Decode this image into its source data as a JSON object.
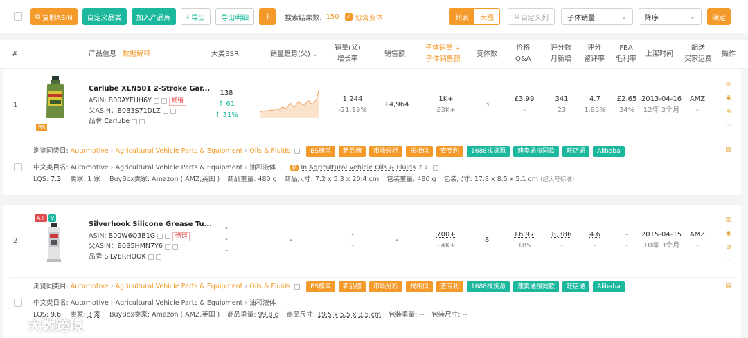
{
  "toolbar": {
    "copy_asin": "复制ASIN",
    "custom_category": "自定义品类",
    "add_to_library": "加入产品库",
    "export": "导出",
    "export_detail": "导出明细",
    "more": "⋮",
    "result_label": "搜索结果数:",
    "result_count": "150",
    "include_variants": "包含变体",
    "view_list": "列表",
    "view_grid": "大图",
    "custom_columns": "自定义列",
    "sort_field": "子体销量",
    "sort_order": "降序",
    "confirm": "确定"
  },
  "headers": {
    "index": "#",
    "product_info": "产品信息",
    "data_explain": "数据解释",
    "bsr": "大类BSR",
    "sales_trend": "销量趋势(父)",
    "sales_parent": "销量(父)",
    "growth": "增长率",
    "revenue": "销售额",
    "child_sales": "子体销量",
    "child_revenue": "子体销售额",
    "variants": "变体数",
    "price": "价格",
    "qa": "Q&A",
    "reviews": "评分数",
    "monthly_new": "月新增",
    "rating": "评分",
    "retention": "留评率",
    "fba": "FBA",
    "margin": "毛利率",
    "launch": "上架时间",
    "delivery": "配送",
    "buyer_shipping": "买家运费",
    "ops": "操作"
  },
  "products": [
    {
      "index": "1",
      "title": "Carlube XLN501 2-Stroke Gar...",
      "asin_label": "ASIN:",
      "asin": "B00AYEUH6Y",
      "hot": "畅销",
      "parent_label": "父ASIN：",
      "parent_asin": "B0B3S71DLZ",
      "brand_label": "品牌:",
      "brand": "Carlube",
      "badge": "BS",
      "bsr": "138",
      "bsr_change": "↑ 61",
      "bsr_pct": "↑ 31%",
      "sales": "1,244",
      "growth": "-21.19%",
      "revenue": "£4,964",
      "child_sales": "1K+",
      "child_revenue": "£3K+",
      "variants": "3",
      "price": "£3.99",
      "qa": "-",
      "reviews": "341",
      "monthly_new": "23",
      "rating": "4.7",
      "retention": "1.85%",
      "fba": "£2.65",
      "margin": "34%",
      "launch": "2013-04-16",
      "age": "12年 3个月",
      "delivery": "AMZ",
      "shipping": "-",
      "browse_label": "浏览同类目:",
      "browse_path": [
        "Automotive",
        "Agricultural Vehicle Parts & Equipment",
        "Oils & Fluids"
      ],
      "cn_label": "中文类目名:",
      "cn_path": [
        "Automotive",
        "Agricultural Vehicle Parts & Equipment",
        "油和液体"
      ],
      "cn_extra_badge": "新",
      "cn_extra": "In Agricultural Vehicle Oils & Fluids",
      "cn_extra_arrows": "↑↓",
      "lqs_label": "LQS:",
      "lqs": "7.3",
      "sellers_label": "卖家:",
      "sellers": "1 家",
      "buybox_label": "BuyBox卖家:",
      "buybox": "Amazon ( AMZ,英国 )",
      "weight_label": "商品重量:",
      "weight": "480 g",
      "size_label": "商品尺寸:",
      "size": "7.2 x 5.3 x 20.4 cm",
      "pkg_weight_label": "包装重量:",
      "pkg_weight": "480 g",
      "pkg_size_label": "包装尺寸:",
      "pkg_size": "17.8 x 8.5 x 5.1 cm",
      "pkg_note": "(超大号标准)",
      "trend": [
        12,
        14,
        13,
        15,
        14,
        16,
        15,
        17,
        19,
        16,
        18,
        22,
        20,
        19,
        26,
        30,
        24,
        22,
        28,
        34,
        30,
        27,
        26,
        32,
        36,
        30,
        28,
        33,
        38,
        58
      ]
    },
    {
      "index": "2",
      "title": "Silverhook Silicone Grease Tu...",
      "asin_label": "ASIN:",
      "asin": "B00W6Q3B1G",
      "hot": "畅销",
      "parent_label": "父ASIN：",
      "parent_asin": "B0B5HMN7Y6",
      "brand_label": "品牌:",
      "brand": "SILVERHOOK",
      "badge_a": "A+",
      "badge_v": "V",
      "bsr": "-",
      "bsr_change": "-",
      "bsr_pct": "-",
      "sales": "-",
      "growth": "-",
      "revenue": "-",
      "child_sales": "700+",
      "child_revenue": "£4K+",
      "variants": "8",
      "price": "£6.97",
      "qa": "185",
      "reviews": "8,386",
      "monthly_new": "-",
      "rating": "4.6",
      "retention": "-",
      "fba": "-",
      "margin": "-",
      "launch": "2015-04-15",
      "age": "10年 3个月",
      "delivery": "AMZ",
      "shipping": "-",
      "browse_label": "浏览同类目:",
      "browse_path": [
        "Automotive",
        "Agricultural Vehicle Parts & Equipment",
        "Oils & Fluids"
      ],
      "cn_label": "中文类目名:",
      "cn_path": [
        "Automotive",
        "Agricultural Vehicle Parts & Equipment",
        "油和液体"
      ],
      "lqs_label": "LQS:",
      "lqs": "9.6",
      "sellers_label": "卖家:",
      "sellers": "3 家",
      "buybox_label": "BuyBox卖家:",
      "buybox": "Amazon ( AMZ,英国 )",
      "weight_label": "商品重量:",
      "weight": "99.8 g",
      "size_label": "商品尺寸:",
      "size": "19.5 x 5.5 x 3.5 cm",
      "pkg_weight_label": "包装重量:",
      "pkg_weight": "--",
      "pkg_size_label": "包装尺寸:",
      "pkg_size": "--"
    }
  ],
  "action_tags": [
    "BS榜单",
    "新品榜",
    "市场分析",
    "找相似",
    "查专利",
    "1688找货源",
    "速卖通搜同款",
    "旺店通",
    "Alibaba"
  ],
  "watermark": "大数跨境",
  "colors": {
    "accent": "#f39a2b",
    "teal": "#1cb89d",
    "red": "#e04b4b"
  }
}
